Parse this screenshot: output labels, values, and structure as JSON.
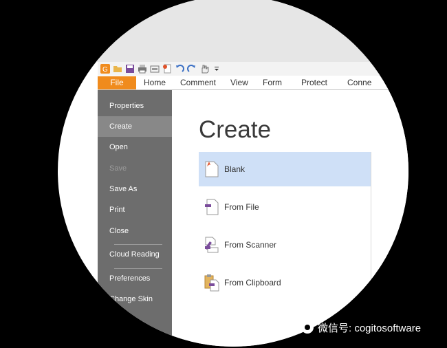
{
  "quick_access": {
    "icons": [
      "app-logo-icon",
      "open-folder-icon",
      "save-icon",
      "print-icon",
      "scan-icon",
      "new-icon",
      "undo-icon",
      "redo-icon",
      "hand-tool-icon",
      "customize-arrow-icon"
    ]
  },
  "ribbon": {
    "tabs": [
      "File",
      "Home",
      "Comment",
      "View",
      "Form",
      "Protect",
      "Conne"
    ]
  },
  "sidebar": {
    "items": [
      "Properties",
      "Create",
      "Open",
      "Save",
      "Save As",
      "Print",
      "Close",
      "Cloud Reading",
      "Preferences",
      "Change Skin"
    ]
  },
  "content": {
    "title": "Create",
    "options": [
      "Blank",
      "From File",
      "From Scanner",
      "From Clipboard"
    ]
  },
  "watermark": {
    "text": "微信号: cogitosoftware"
  },
  "colors": {
    "accent": "#f08b1d",
    "selected": "#cfe0f7",
    "sidebar": "#6d6d6d"
  }
}
